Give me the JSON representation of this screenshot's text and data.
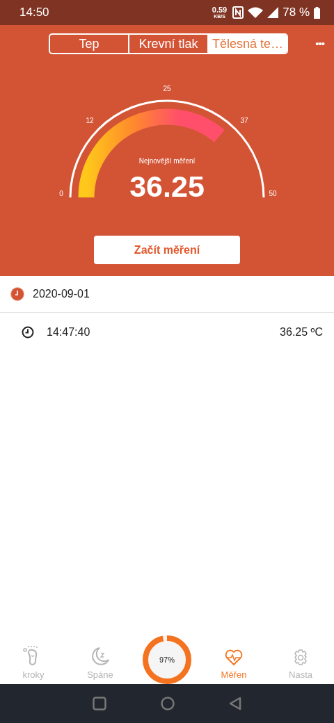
{
  "status_bar": {
    "time": "14:50",
    "speed": "0.59",
    "speed_unit": "KB/S",
    "battery": "78 %"
  },
  "tabs": [
    {
      "label": "Tep",
      "selected": false
    },
    {
      "label": "Krevní tlak",
      "selected": false
    },
    {
      "label": "Tělesná te…",
      "selected": true
    }
  ],
  "more": "•••",
  "gauge": {
    "ticks": [
      "0",
      "12",
      "25",
      "37",
      "50"
    ],
    "caption": "Nejnovější měření",
    "value": "36.25"
  },
  "start_button": "Začít měření",
  "records": {
    "date": "2020-09-01",
    "items": [
      {
        "time": "14:47:40",
        "value": "36.25 ºC"
      }
    ]
  },
  "nav": [
    {
      "kind": "steps",
      "label": "kroky",
      "selected": false
    },
    {
      "kind": "sleep",
      "label": "Spáne",
      "selected": false
    },
    {
      "kind": "ring",
      "label": "97%",
      "level": 0.97
    },
    {
      "kind": "measure",
      "label": "Měřen",
      "selected": true
    },
    {
      "kind": "settings",
      "label": "Nasta",
      "selected": false
    }
  ]
}
